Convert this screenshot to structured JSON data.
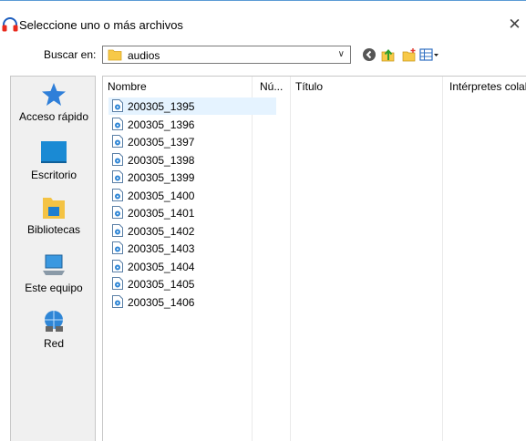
{
  "dialog": {
    "title": "Seleccione uno o más archivos",
    "close_glyph": "✕"
  },
  "lookin": {
    "label": "Buscar en:",
    "value": "audios"
  },
  "toolbar": [
    {
      "name": "back-icon"
    },
    {
      "name": "up-folder-icon"
    },
    {
      "name": "new-folder-icon"
    },
    {
      "name": "view-menu-icon"
    }
  ],
  "places": [
    {
      "label": "Acceso rápido",
      "icon": "star-icon"
    },
    {
      "label": "Escritorio",
      "icon": "desktop-icon"
    },
    {
      "label": "Bibliotecas",
      "icon": "libraries-icon"
    },
    {
      "label": "Este equipo",
      "icon": "computer-icon"
    },
    {
      "label": "Red",
      "icon": "network-icon"
    }
  ],
  "columns": [
    "Nombre",
    "Nú...",
    "Título",
    "Intérpretes colal"
  ],
  "files": [
    "200305_1395",
    "200305_1396",
    "200305_1397",
    "200305_1398",
    "200305_1399",
    "200305_1400",
    "200305_1401",
    "200305_1402",
    "200305_1403",
    "200305_1404",
    "200305_1405",
    "200305_1406"
  ],
  "selected_index": 0
}
